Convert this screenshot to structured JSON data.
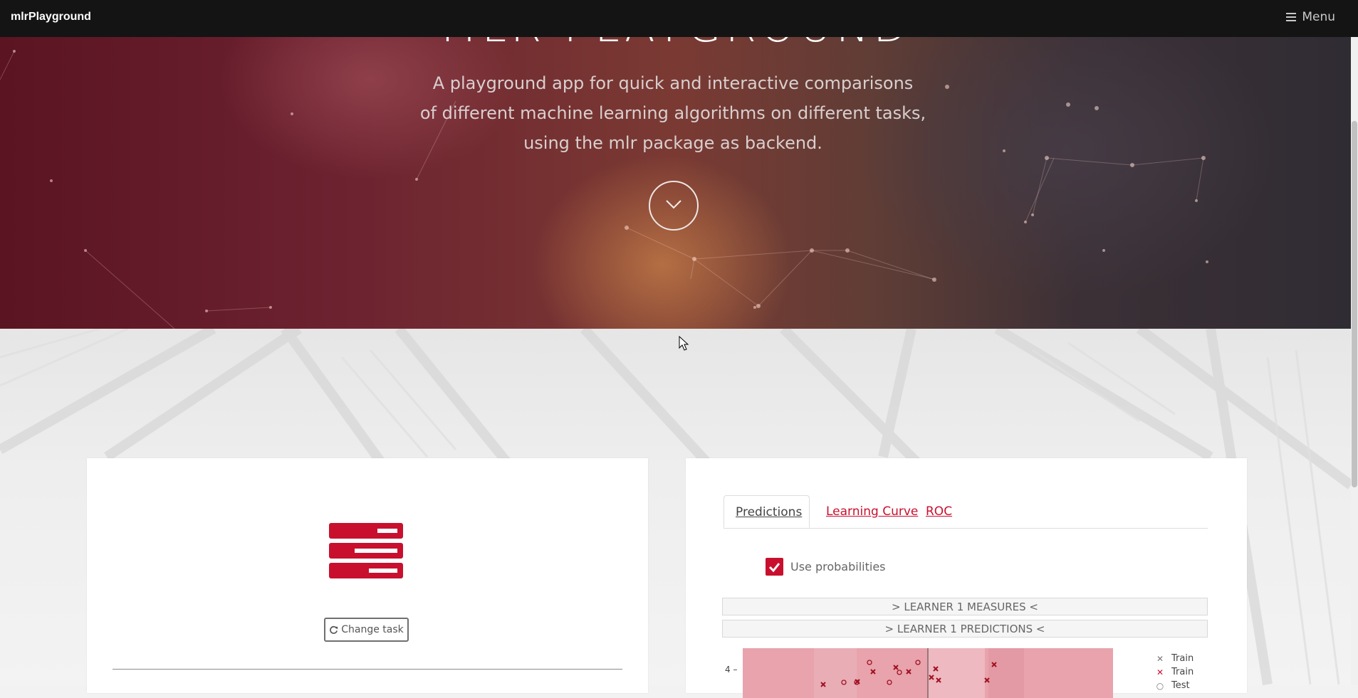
{
  "navbar": {
    "brand": "mlrPlayground",
    "menu_label": "Menu"
  },
  "hero": {
    "title": "MLR PLAYGROUND",
    "description_lines": [
      "A playground app for quick and interactive comparisons",
      "of different machine learning algorithms on different tasks,",
      "using the mlr package as backend."
    ]
  },
  "task_card": {
    "change_task_label": "Change task"
  },
  "results_card": {
    "tabs": [
      {
        "label": "Predictions",
        "active": true
      },
      {
        "label": "Learning Curve",
        "active": false
      },
      {
        "label": "ROC",
        "active": false
      }
    ],
    "use_probabilities": {
      "label": "Use probabilities",
      "checked": true
    },
    "learner_measures_label": "> LEARNER 1 MEASURES <",
    "learner_predictions_label": "> LEARNER 1 PREDICTIONS <",
    "plot": {
      "y_tick": "4",
      "legend": [
        {
          "label": "Train",
          "marker": "x",
          "color": "#777777"
        },
        {
          "label": "Train",
          "marker": "x",
          "color": "#c8102e"
        },
        {
          "label": "Test",
          "marker": "o",
          "color": "#777777"
        }
      ]
    }
  },
  "colors": {
    "accent": "#c8102e",
    "navbar": "#141414"
  }
}
